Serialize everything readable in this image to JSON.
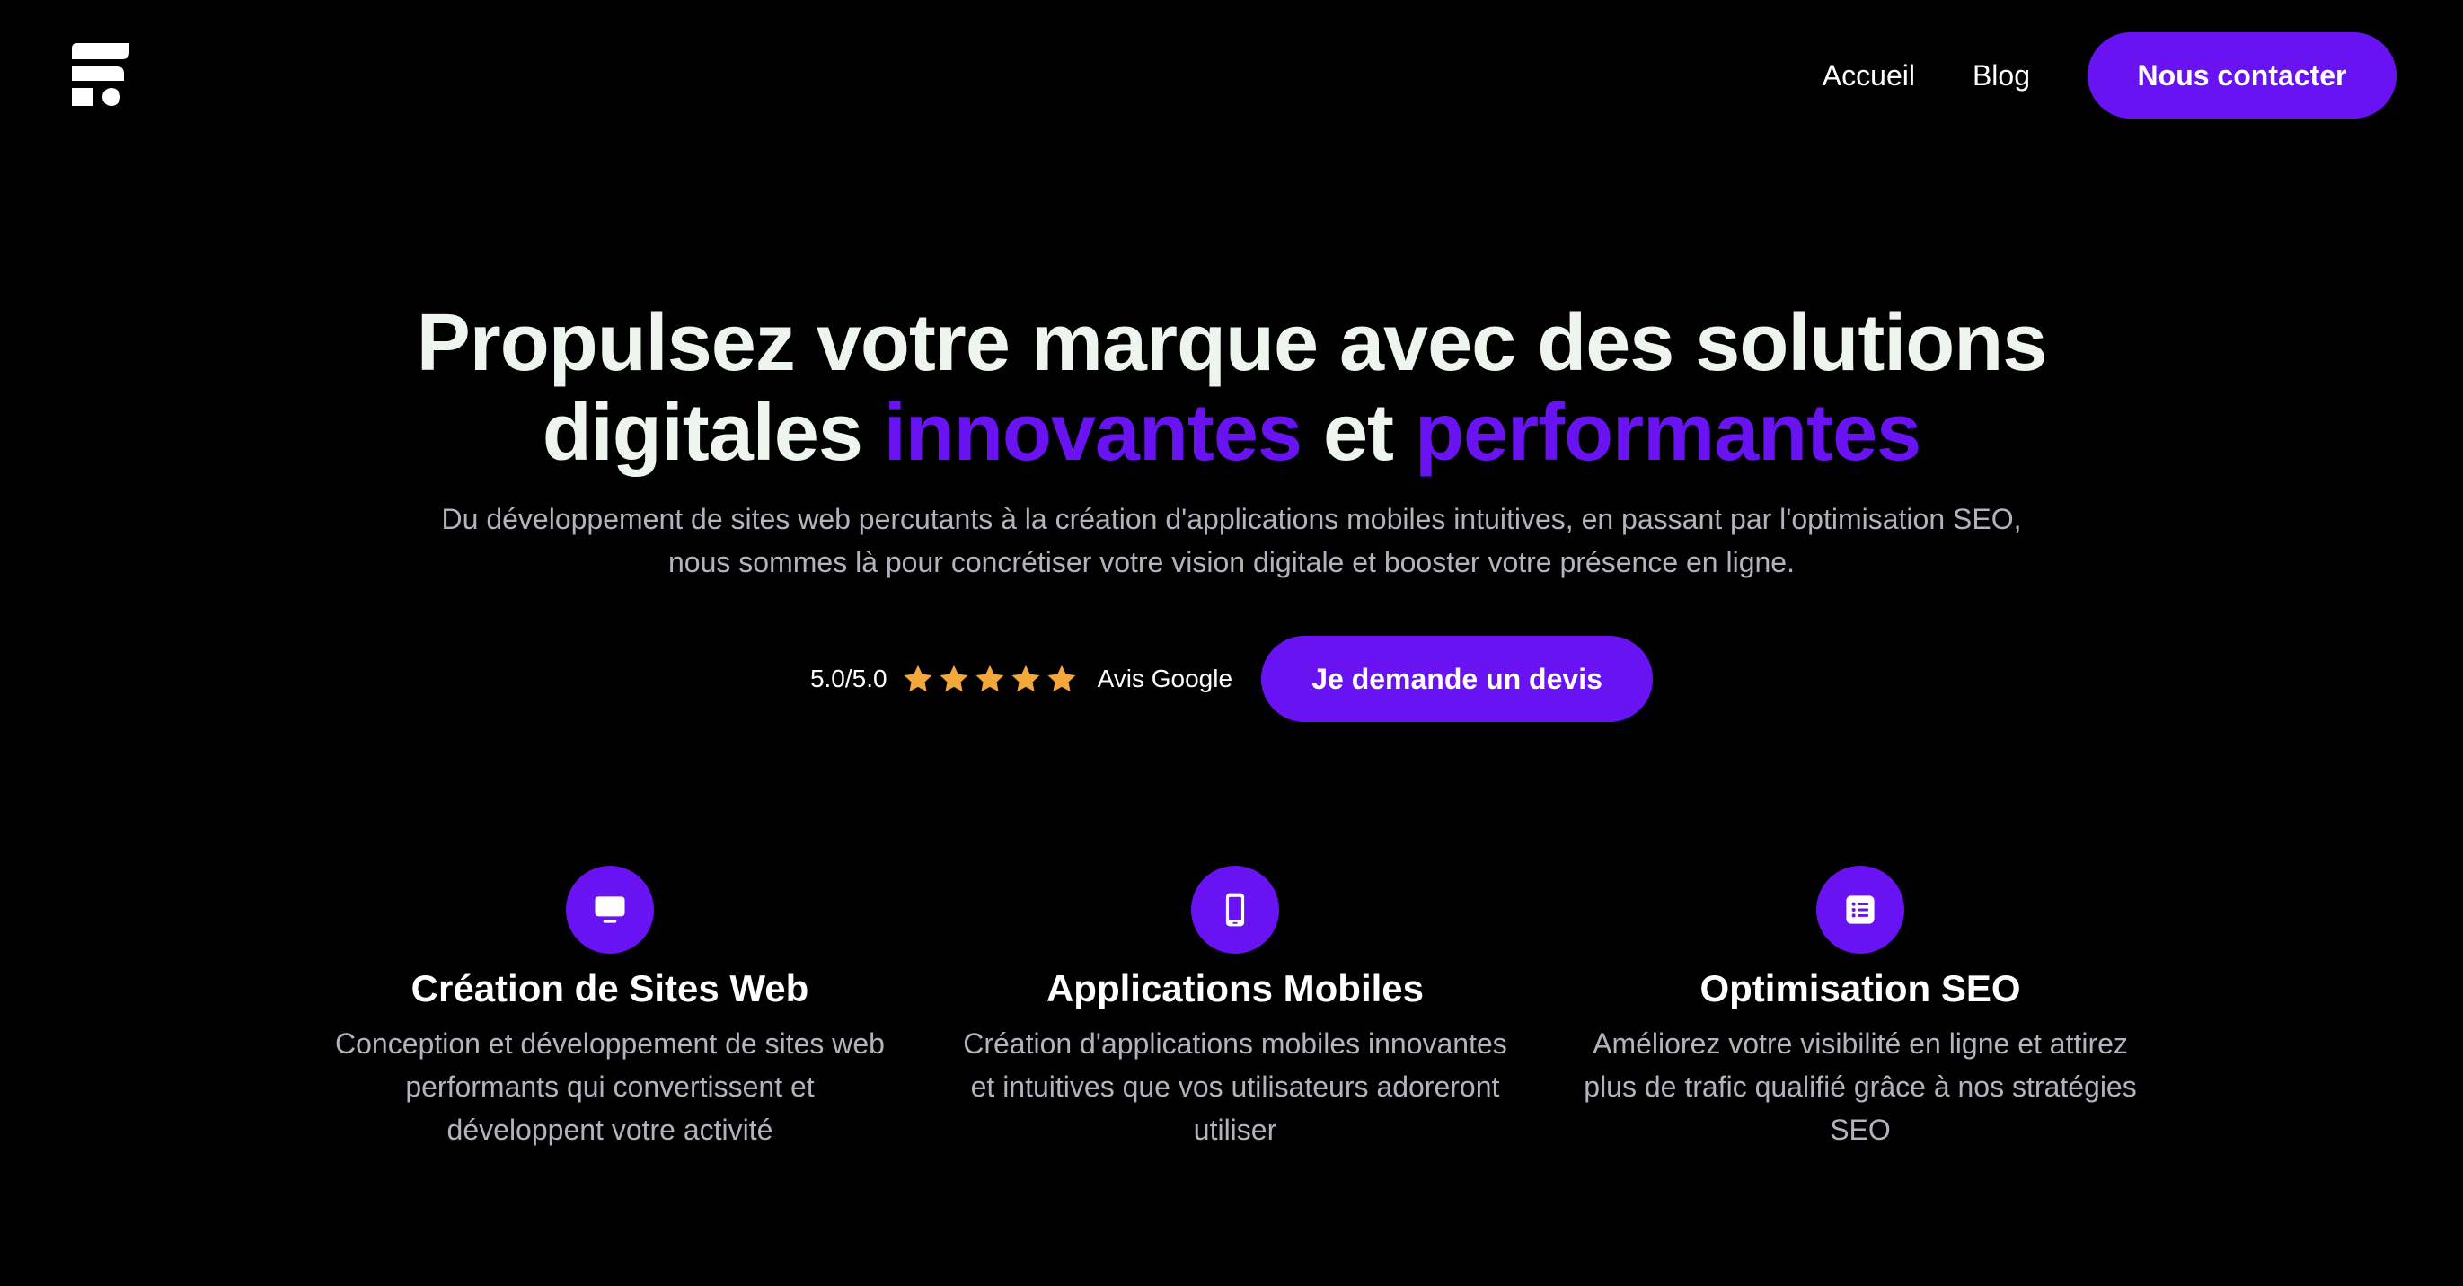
{
  "header": {
    "logo_icon": "brand-logo-icon",
    "nav": [
      {
        "label": "Accueil"
      },
      {
        "label": "Blog"
      }
    ],
    "cta_label": "Nous contacter"
  },
  "hero": {
    "title_line1": "Propulsez votre marque avec des solutions",
    "title_line2_a": "digitales ",
    "title_accent1": "innovantes",
    "title_line2_b": " et ",
    "title_accent2": "performantes",
    "subtitle": "Du développement de sites web percutants à la création d'applications mobiles intuitives, en passant par l'optimisation SEO, nous sommes là pour concrétiser votre vision digitale et booster votre présence en ligne.",
    "rating_score": "5.0/5.0",
    "rating_stars": 5,
    "rating_label": "Avis Google",
    "cta_label": "Je demande un devis"
  },
  "features": [
    {
      "icon": "monitor-icon",
      "title": "Création de Sites Web",
      "description": "Conception et développement de sites web performants qui convertissent et développent votre activité"
    },
    {
      "icon": "smartphone-icon",
      "title": "Applications Mobiles",
      "description": "Création d'applications mobiles innovantes et intuitives que vos utilisateurs adoreront utiliser"
    },
    {
      "icon": "list-icon",
      "title": "Optimisation SEO",
      "description": "Améliorez votre visibilité en ligne et attirez plus de trafic qualifié grâce à nos stratégies SEO"
    }
  ],
  "colors": {
    "background": "#000000",
    "accent": "#6a13f2",
    "heading": "#eef5ef",
    "muted_text": "#b3b3bd",
    "star": "#f5a83a"
  }
}
